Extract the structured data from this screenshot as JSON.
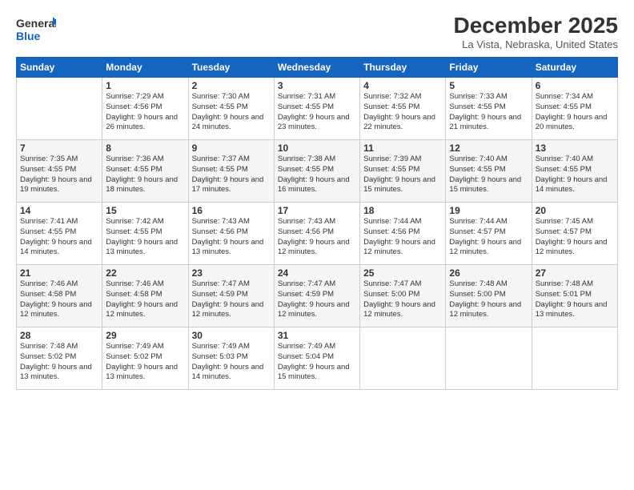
{
  "logo": {
    "text_general": "General",
    "text_blue": "Blue"
  },
  "header": {
    "month_year": "December 2025",
    "location": "La Vista, Nebraska, United States"
  },
  "days_of_week": [
    "Sunday",
    "Monday",
    "Tuesday",
    "Wednesday",
    "Thursday",
    "Friday",
    "Saturday"
  ],
  "weeks": [
    [
      {
        "day": "",
        "sunrise": "",
        "sunset": "",
        "daylight": ""
      },
      {
        "day": "1",
        "sunrise": "Sunrise: 7:29 AM",
        "sunset": "Sunset: 4:56 PM",
        "daylight": "Daylight: 9 hours and 26 minutes."
      },
      {
        "day": "2",
        "sunrise": "Sunrise: 7:30 AM",
        "sunset": "Sunset: 4:55 PM",
        "daylight": "Daylight: 9 hours and 24 minutes."
      },
      {
        "day": "3",
        "sunrise": "Sunrise: 7:31 AM",
        "sunset": "Sunset: 4:55 PM",
        "daylight": "Daylight: 9 hours and 23 minutes."
      },
      {
        "day": "4",
        "sunrise": "Sunrise: 7:32 AM",
        "sunset": "Sunset: 4:55 PM",
        "daylight": "Daylight: 9 hours and 22 minutes."
      },
      {
        "day": "5",
        "sunrise": "Sunrise: 7:33 AM",
        "sunset": "Sunset: 4:55 PM",
        "daylight": "Daylight: 9 hours and 21 minutes."
      },
      {
        "day": "6",
        "sunrise": "Sunrise: 7:34 AM",
        "sunset": "Sunset: 4:55 PM",
        "daylight": "Daylight: 9 hours and 20 minutes."
      }
    ],
    [
      {
        "day": "7",
        "sunrise": "Sunrise: 7:35 AM",
        "sunset": "Sunset: 4:55 PM",
        "daylight": "Daylight: 9 hours and 19 minutes."
      },
      {
        "day": "8",
        "sunrise": "Sunrise: 7:36 AM",
        "sunset": "Sunset: 4:55 PM",
        "daylight": "Daylight: 9 hours and 18 minutes."
      },
      {
        "day": "9",
        "sunrise": "Sunrise: 7:37 AM",
        "sunset": "Sunset: 4:55 PM",
        "daylight": "Daylight: 9 hours and 17 minutes."
      },
      {
        "day": "10",
        "sunrise": "Sunrise: 7:38 AM",
        "sunset": "Sunset: 4:55 PM",
        "daylight": "Daylight: 9 hours and 16 minutes."
      },
      {
        "day": "11",
        "sunrise": "Sunrise: 7:39 AM",
        "sunset": "Sunset: 4:55 PM",
        "daylight": "Daylight: 9 hours and 15 minutes."
      },
      {
        "day": "12",
        "sunrise": "Sunrise: 7:40 AM",
        "sunset": "Sunset: 4:55 PM",
        "daylight": "Daylight: 9 hours and 15 minutes."
      },
      {
        "day": "13",
        "sunrise": "Sunrise: 7:40 AM",
        "sunset": "Sunset: 4:55 PM",
        "daylight": "Daylight: 9 hours and 14 minutes."
      }
    ],
    [
      {
        "day": "14",
        "sunrise": "Sunrise: 7:41 AM",
        "sunset": "Sunset: 4:55 PM",
        "daylight": "Daylight: 9 hours and 14 minutes."
      },
      {
        "day": "15",
        "sunrise": "Sunrise: 7:42 AM",
        "sunset": "Sunset: 4:55 PM",
        "daylight": "Daylight: 9 hours and 13 minutes."
      },
      {
        "day": "16",
        "sunrise": "Sunrise: 7:43 AM",
        "sunset": "Sunset: 4:56 PM",
        "daylight": "Daylight: 9 hours and 13 minutes."
      },
      {
        "day": "17",
        "sunrise": "Sunrise: 7:43 AM",
        "sunset": "Sunset: 4:56 PM",
        "daylight": "Daylight: 9 hours and 12 minutes."
      },
      {
        "day": "18",
        "sunrise": "Sunrise: 7:44 AM",
        "sunset": "Sunset: 4:56 PM",
        "daylight": "Daylight: 9 hours and 12 minutes."
      },
      {
        "day": "19",
        "sunrise": "Sunrise: 7:44 AM",
        "sunset": "Sunset: 4:57 PM",
        "daylight": "Daylight: 9 hours and 12 minutes."
      },
      {
        "day": "20",
        "sunrise": "Sunrise: 7:45 AM",
        "sunset": "Sunset: 4:57 PM",
        "daylight": "Daylight: 9 hours and 12 minutes."
      }
    ],
    [
      {
        "day": "21",
        "sunrise": "Sunrise: 7:46 AM",
        "sunset": "Sunset: 4:58 PM",
        "daylight": "Daylight: 9 hours and 12 minutes."
      },
      {
        "day": "22",
        "sunrise": "Sunrise: 7:46 AM",
        "sunset": "Sunset: 4:58 PM",
        "daylight": "Daylight: 9 hours and 12 minutes."
      },
      {
        "day": "23",
        "sunrise": "Sunrise: 7:47 AM",
        "sunset": "Sunset: 4:59 PM",
        "daylight": "Daylight: 9 hours and 12 minutes."
      },
      {
        "day": "24",
        "sunrise": "Sunrise: 7:47 AM",
        "sunset": "Sunset: 4:59 PM",
        "daylight": "Daylight: 9 hours and 12 minutes."
      },
      {
        "day": "25",
        "sunrise": "Sunrise: 7:47 AM",
        "sunset": "Sunset: 5:00 PM",
        "daylight": "Daylight: 9 hours and 12 minutes."
      },
      {
        "day": "26",
        "sunrise": "Sunrise: 7:48 AM",
        "sunset": "Sunset: 5:00 PM",
        "daylight": "Daylight: 9 hours and 12 minutes."
      },
      {
        "day": "27",
        "sunrise": "Sunrise: 7:48 AM",
        "sunset": "Sunset: 5:01 PM",
        "daylight": "Daylight: 9 hours and 13 minutes."
      }
    ],
    [
      {
        "day": "28",
        "sunrise": "Sunrise: 7:48 AM",
        "sunset": "Sunset: 5:02 PM",
        "daylight": "Daylight: 9 hours and 13 minutes."
      },
      {
        "day": "29",
        "sunrise": "Sunrise: 7:49 AM",
        "sunset": "Sunset: 5:02 PM",
        "daylight": "Daylight: 9 hours and 13 minutes."
      },
      {
        "day": "30",
        "sunrise": "Sunrise: 7:49 AM",
        "sunset": "Sunset: 5:03 PM",
        "daylight": "Daylight: 9 hours and 14 minutes."
      },
      {
        "day": "31",
        "sunrise": "Sunrise: 7:49 AM",
        "sunset": "Sunset: 5:04 PM",
        "daylight": "Daylight: 9 hours and 15 minutes."
      },
      {
        "day": "",
        "sunrise": "",
        "sunset": "",
        "daylight": ""
      },
      {
        "day": "",
        "sunrise": "",
        "sunset": "",
        "daylight": ""
      },
      {
        "day": "",
        "sunrise": "",
        "sunset": "",
        "daylight": ""
      }
    ]
  ]
}
